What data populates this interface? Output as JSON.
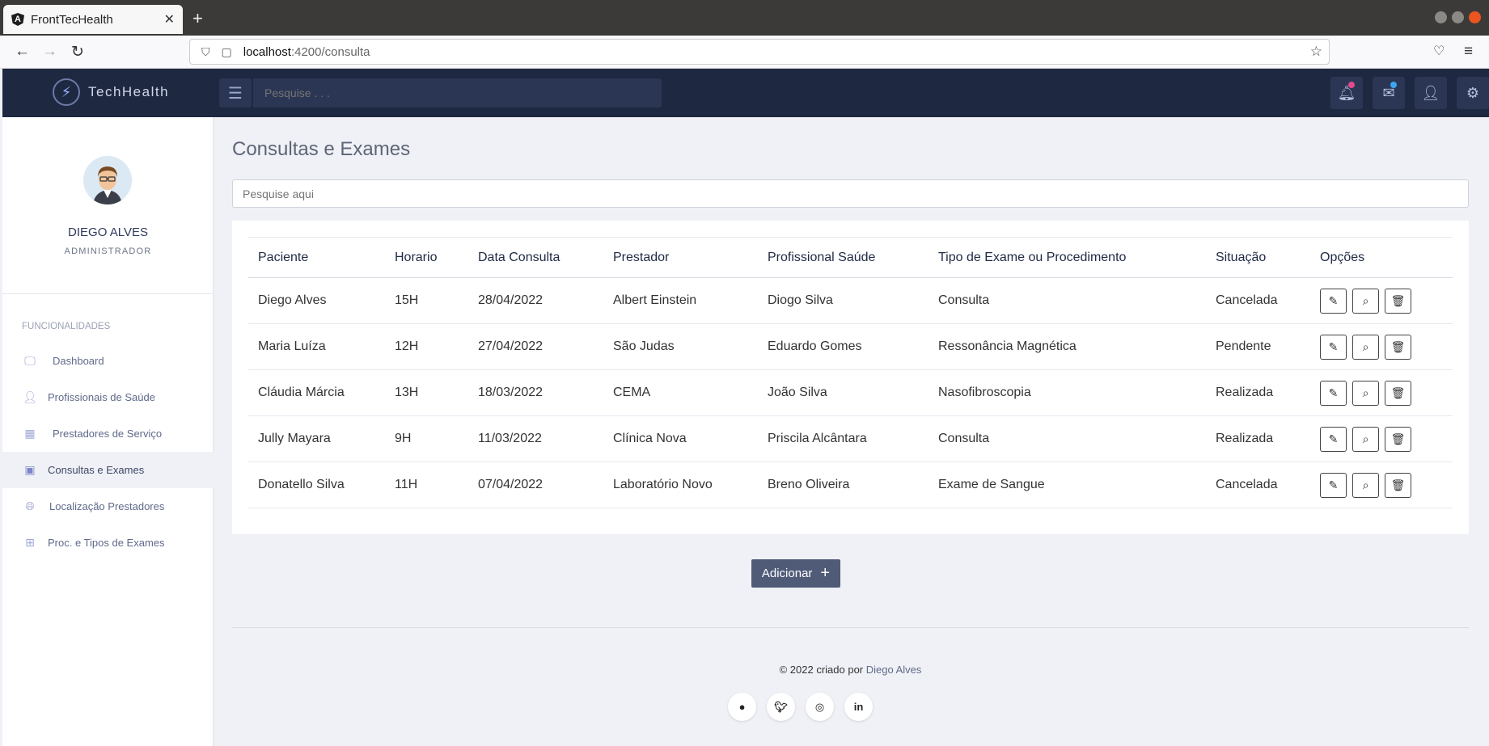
{
  "browser": {
    "tab_title": "FrontTecHealth",
    "tab_close": "✕",
    "new_tab": "+",
    "url_host": "localhost",
    "url_path": ":4200/consulta"
  },
  "header": {
    "brand": "TechHealth",
    "search_placeholder": "Pesquise . . ."
  },
  "user": {
    "name": "DIEGO ALVES",
    "role": "ADMINISTRADOR"
  },
  "sidebar": {
    "section_label": "FUNCIONALIDADES",
    "items": [
      {
        "label": "Dashboard",
        "icon": "monitor-icon"
      },
      {
        "label": "Profissionais de Saúde",
        "icon": "user-md-icon"
      },
      {
        "label": "Prestadores de Serviço",
        "icon": "hospital-icon"
      },
      {
        "label": "Consultas e Exames",
        "icon": "calendar-icon"
      },
      {
        "label": "Localização Prestadores",
        "icon": "globe-icon"
      },
      {
        "label": "Proc. e Tipos de Exames",
        "icon": "plus-square-icon"
      }
    ]
  },
  "main": {
    "title": "Consultas e Exames",
    "search_placeholder": "Pesquise aqui",
    "columns": [
      "Paciente",
      "Horario",
      "Data Consulta",
      "Prestador",
      "Profissional Saúde",
      "Tipo de Exame ou Procedimento",
      "Situação",
      "Opções"
    ],
    "rows": [
      [
        "Diego Alves",
        "15H",
        "28/04/2022",
        "Albert Einstein",
        "Diogo Silva",
        "Consulta",
        "Cancelada"
      ],
      [
        "Maria Luíza",
        "12H",
        "27/04/2022",
        "São Judas",
        "Eduardo Gomes",
        "Ressonância Magnética",
        "Pendente"
      ],
      [
        "Cláudia Márcia",
        "13H",
        "18/03/2022",
        "CEMA",
        "João Silva",
        "Nasofibroscopia",
        "Realizada"
      ],
      [
        "Jully Mayara",
        "9H",
        "11/03/2022",
        "Clínica Nova",
        "Priscila Alcântara",
        "Consulta",
        "Realizada"
      ],
      [
        "Donatello Silva",
        "11H",
        "07/04/2022",
        "Laboratório Novo",
        "Breno Oliveira",
        "Exame de Sangue",
        "Cancelada"
      ]
    ],
    "add_label": "Adicionar"
  },
  "footer": {
    "copyright": "© 2022 criado por",
    "author": "Diego Alves"
  },
  "colors": {
    "header_bg": "#1e2840",
    "accent_button": "#505b78",
    "notification_dot": "#e24a8d",
    "mail_dot": "#3ba6f0"
  }
}
